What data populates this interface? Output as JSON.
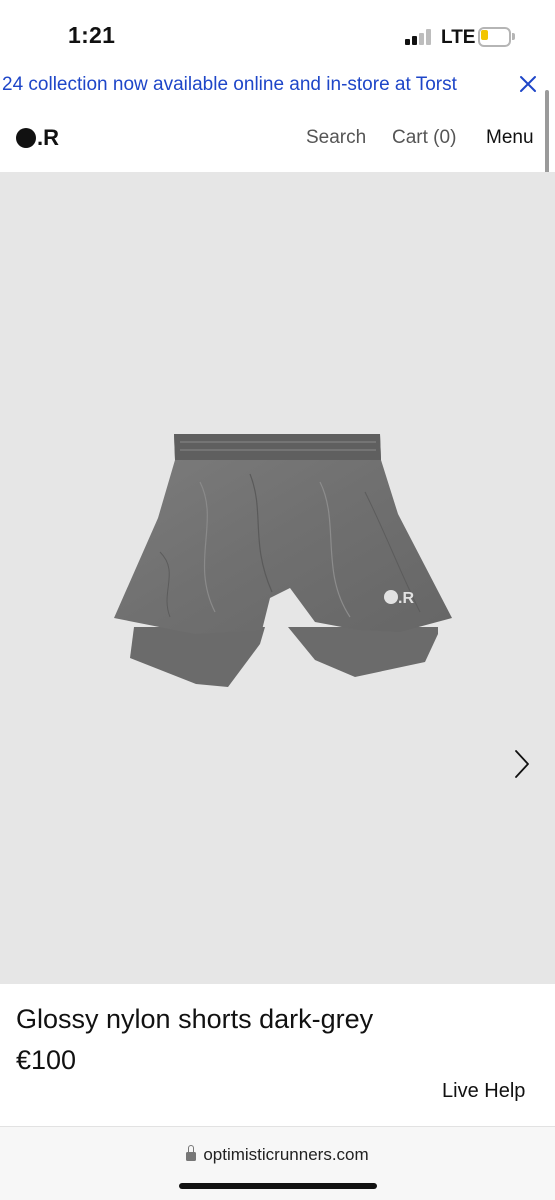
{
  "status_bar": {
    "time": "1:21",
    "network": "LTE",
    "signal_bars_active": 2,
    "signal_bars_total": 4,
    "battery_level": 0.2,
    "battery_color": "#f2c500"
  },
  "announcement": {
    "text": "24 collection now available online and in-store at Torst",
    "color": "#1e46c8",
    "close_icon": "close-icon"
  },
  "header": {
    "logo_text": ".R",
    "search_label": "Search",
    "cart_label": "Cart (0)",
    "menu_label": "Menu"
  },
  "gallery": {
    "image_alt": "product-image-shorts",
    "image_logo_text": ".R",
    "next_icon": "chevron-right-icon",
    "background": "#e6e6e6"
  },
  "product": {
    "title": "Glossy nylon shorts dark-grey",
    "price": "€100"
  },
  "support": {
    "live_help_label": "Live Help"
  },
  "browser": {
    "url": "optimisticrunners.com",
    "lock_icon": "lock-icon"
  }
}
